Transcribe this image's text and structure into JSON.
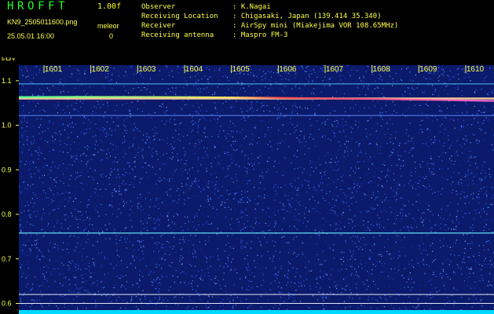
{
  "header": {
    "app_title": "HROFFT",
    "version": "1.00f",
    "filename": "KN9_2505011600.png",
    "mode": "meleor",
    "datetime": "25.05.01 16:00",
    "count": "0"
  },
  "station_info": [
    {
      "label": "Observer",
      "value": ": K.Nagai"
    },
    {
      "label": "Receiving Location",
      "value": ": Chigasaki, Japan (139.414 35.340)"
    },
    {
      "label": "Receiver",
      "value": ": AirSpy mini (Miakejima VOR 108.65MHz)"
    },
    {
      "label": "Receiving antenna",
      "value": ": Maspro FM-3"
    }
  ],
  "chart_data": {
    "type": "heatmap",
    "ylabel": "kHz",
    "x_ticks": [
      "1601",
      "1602",
      "1603",
      "1604",
      "1605",
      "1606",
      "1607",
      "1608",
      "1609",
      "1610"
    ],
    "y_ticks": [
      "1.1",
      "1.0",
      "0.9",
      "0.8",
      "0.7",
      "0.6"
    ],
    "y_range": [
      0.585,
      1.135
    ],
    "bright_traces_khz": [
      1.093,
      1.06,
      1.022,
      0.758,
      0.62,
      0.6
    ],
    "colors": {
      "background": "#0b1a6a",
      "noise": "#3a60ff",
      "trace_hot": "#ff4a4a",
      "trace_mid": "#44ff88",
      "baseline": "#00d8ff",
      "tick_label": "#ffff44"
    }
  }
}
